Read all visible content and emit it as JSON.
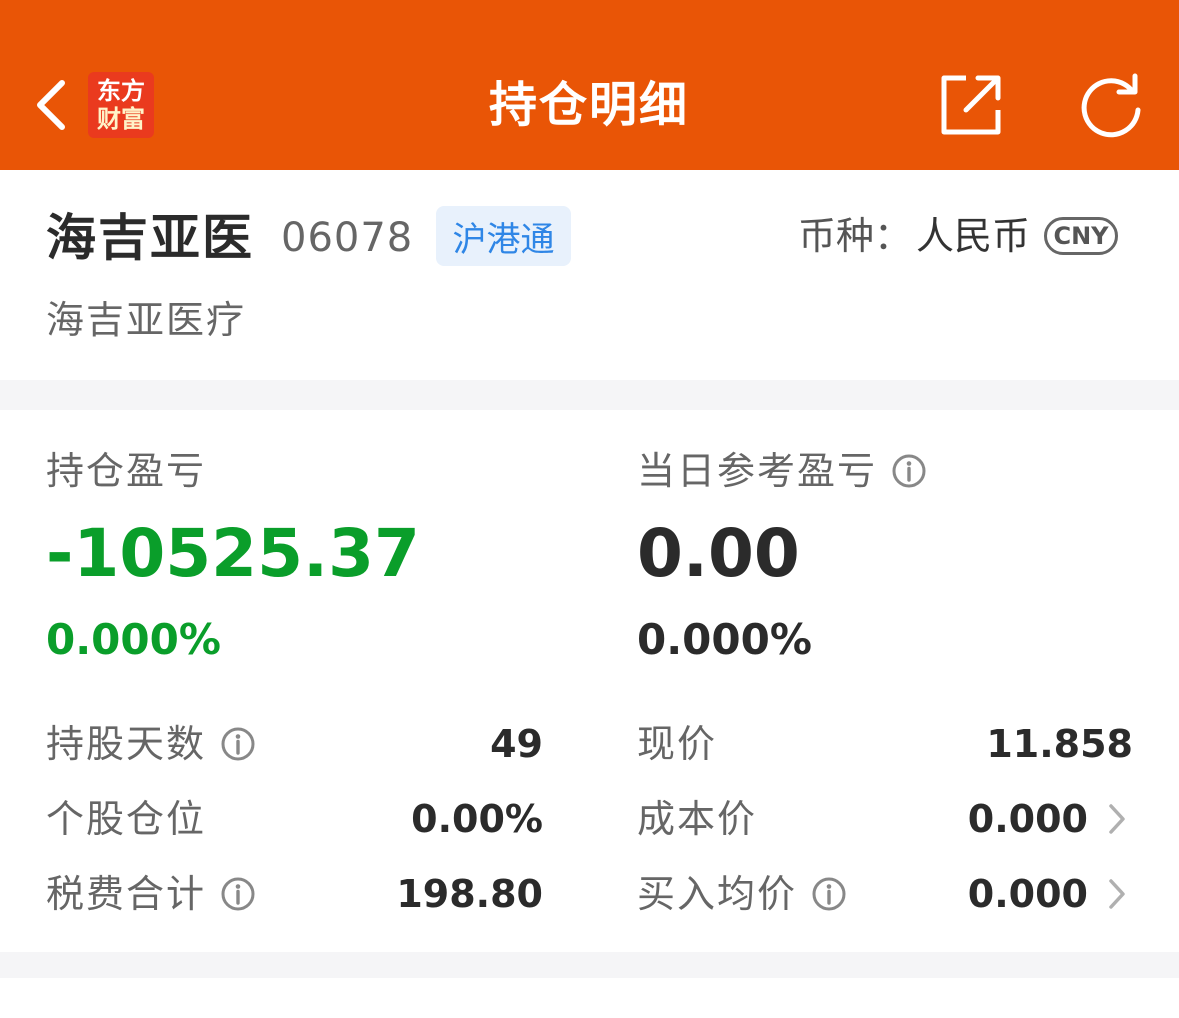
{
  "header": {
    "title": "持仓明细",
    "logo_line1": "东方",
    "logo_line2": "财富",
    "back_icon": "chevron-left-icon",
    "share_icon": "share-icon",
    "refresh_icon": "refresh-icon",
    "bg_color": "#e95506"
  },
  "stock": {
    "name": "海吉亚医",
    "code": "06078",
    "market_tag": "沪港通",
    "currency_label": "币种：",
    "currency_value": "人民币",
    "currency_badge": "CNY",
    "full_name": "海吉亚医疗"
  },
  "pnl": {
    "holding_pnl_label": "持仓盈亏",
    "holding_pnl_value": "-10525.37",
    "holding_pnl_pct": "0.000%",
    "daily_pnl_label": "当日参考盈亏",
    "daily_pnl_value": "0.00",
    "daily_pnl_pct": "0.000%",
    "negative_color": "#0a9e2a"
  },
  "details": {
    "left": [
      {
        "label": "持股天数",
        "value": "49",
        "info": true
      },
      {
        "label": "个股仓位",
        "value": "0.00%",
        "info": false
      },
      {
        "label": "税费合计",
        "value": "198.80",
        "info": true
      }
    ],
    "right": [
      {
        "label": "现价",
        "value": "11.858",
        "info": false,
        "chevron": false
      },
      {
        "label": "成本价",
        "value": "0.000",
        "info": false,
        "chevron": true
      },
      {
        "label": "买入均价",
        "value": "0.000",
        "info": true,
        "chevron": true
      }
    ]
  }
}
